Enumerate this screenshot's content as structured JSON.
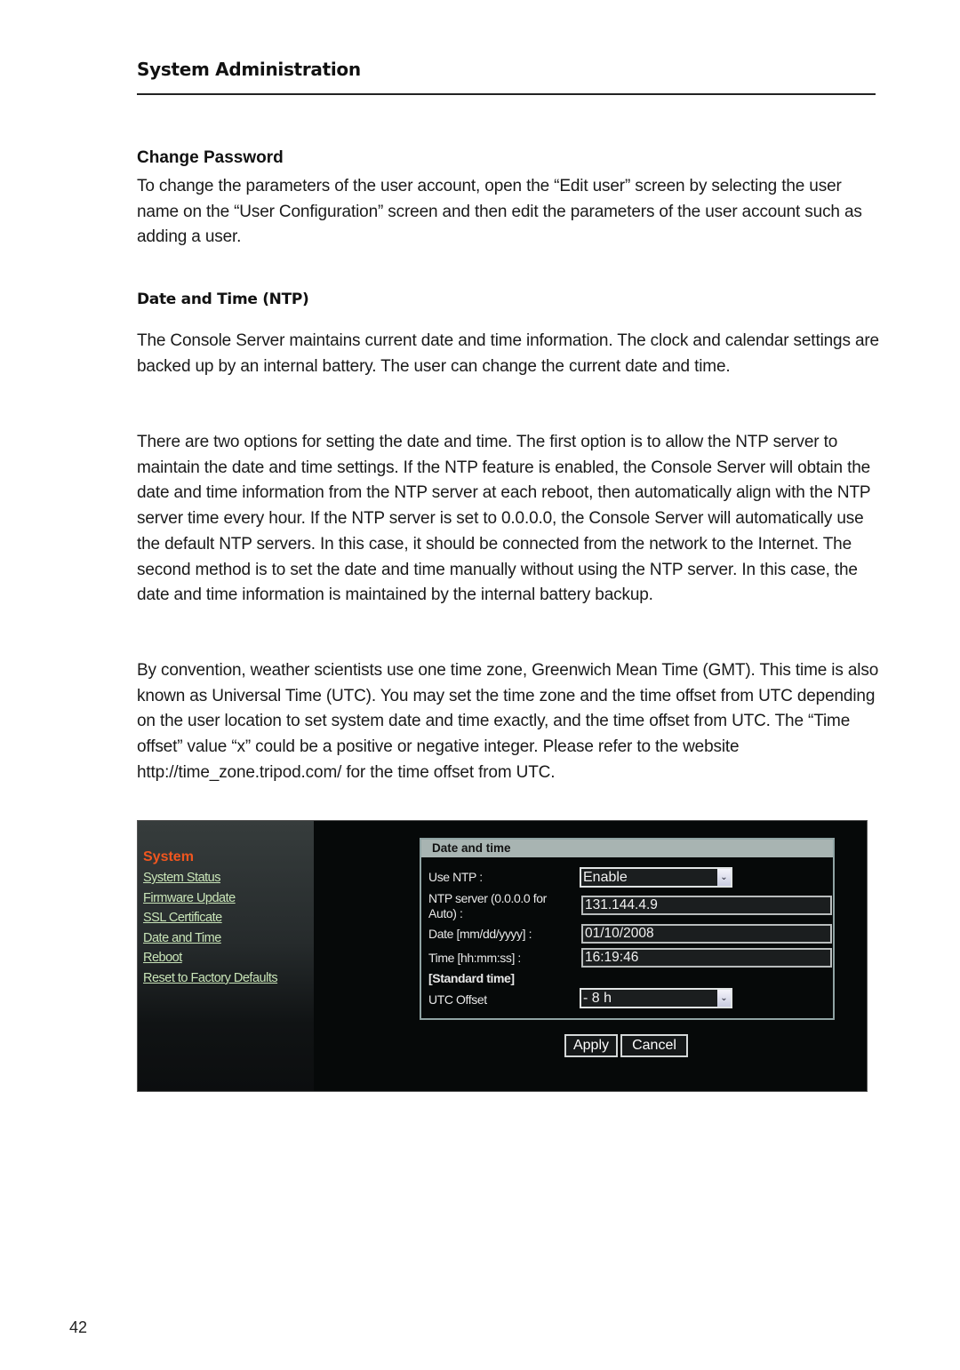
{
  "header": {
    "section_title": "System Administration"
  },
  "change_password": {
    "heading": "Change Password",
    "body": "To change the parameters of the user account, open the “Edit user” screen by selecting the user name on the “User Configuration” screen and then edit the parameters of the user account such as adding a user."
  },
  "ntp": {
    "heading": "Date and Time (NTP)",
    "paragraphs": [
      "The Console Server maintains current date and time information. The clock and calendar settings are backed up by an internal battery. The user can change the current date and time.",
      "There are two options for setting the date and time. The first option is to allow the NTP server to maintain the date and time settings. If the NTP feature is enabled, the Console Server will obtain the date and time information from the NTP server at each reboot, then automatically align with the NTP server time every hour. If the NTP server is set to 0.0.0.0, the Console Server will automatically use the default NTP servers. In this case, it should be connected from the network to the Internet. The second method is to set the date and time manually without using the NTP server. In this case, the date and time information is maintained by the internal battery backup.",
      "By convention, weather scientists use one time zone, Greenwich Mean Time (GMT). This time is also known as Universal Time (UTC). You may set the time zone and the time offset from UTC depending on the user location to set system date and time exactly, and the time offset from UTC. The “Time offset” value “x” could be a positive or negative integer. Please refer to the website http://time_zone.tripod.com/ for the time offset from UTC."
    ]
  },
  "screenshot": {
    "sidebar": {
      "title": "System",
      "links": [
        "System Status",
        "Firmware Update",
        "SSL Certificate",
        "Date and Time",
        "Reboot",
        "Reset to Factory Defaults"
      ]
    },
    "panel": {
      "title": "Date and time",
      "use_ntp_label": "Use NTP :",
      "use_ntp_value": "Enable",
      "ntp_server_label_1": "NTP server (0.0.0.0 for",
      "ntp_server_label_2": "Auto) :",
      "ntp_server_value": "131.144.4.9",
      "date_label": "Date [mm/dd/yyyy] :",
      "date_value": "01/10/2008",
      "time_label": "Time [hh:mm:ss] :",
      "time_value": "16:19:46",
      "standard_time_label": "[Standard time]",
      "utc_offset_label": "UTC Offset",
      "utc_offset_value": "- 8 h",
      "dropdown_arrow": "⌄"
    },
    "buttons": {
      "apply": "Apply",
      "cancel": "Cancel"
    }
  },
  "footer": {
    "page_number": "42"
  }
}
